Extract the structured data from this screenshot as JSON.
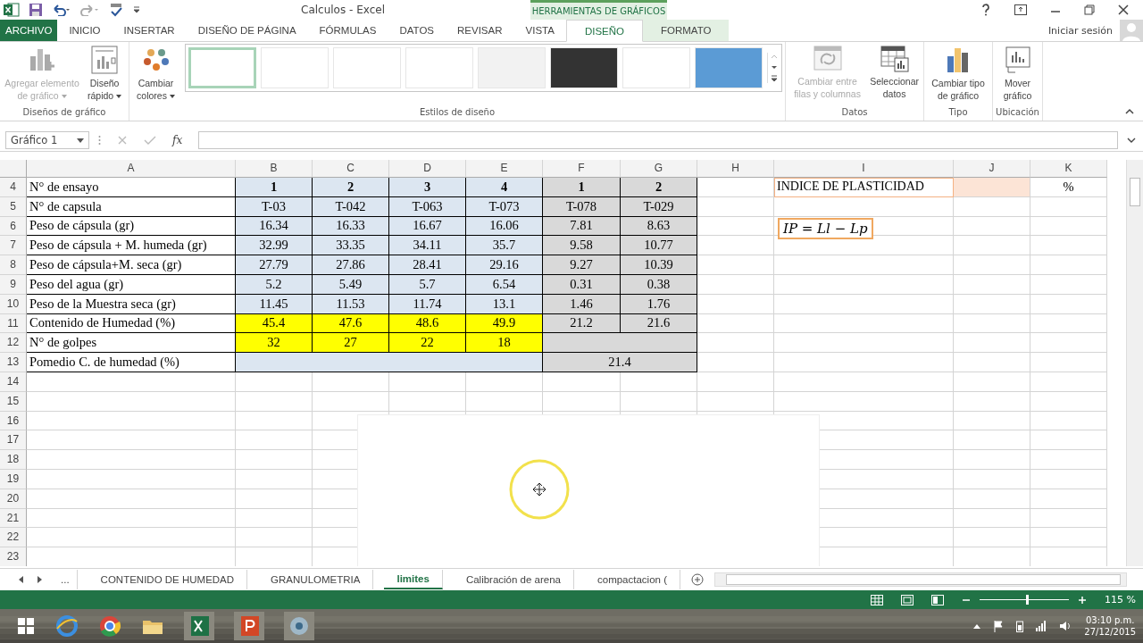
{
  "window": {
    "title": "Calculos - Excel",
    "contextual_header": "HERRAMIENTAS DE GRÁFICOS",
    "account": "Iniciar sesión"
  },
  "tabs": [
    {
      "label": "ARCHIVO",
      "kind": "file",
      "selected": false
    },
    {
      "label": "INICIO",
      "kind": "normal",
      "selected": false
    },
    {
      "label": "INSERTAR",
      "kind": "normal",
      "selected": false
    },
    {
      "label": "DISEÑO DE PÁGINA",
      "kind": "normal",
      "selected": false
    },
    {
      "label": "FÓRMULAS",
      "kind": "normal",
      "selected": false
    },
    {
      "label": "DATOS",
      "kind": "normal",
      "selected": false
    },
    {
      "label": "REVISAR",
      "kind": "normal",
      "selected": false
    },
    {
      "label": "VISTA",
      "kind": "normal",
      "selected": false
    },
    {
      "label": "DISEÑO",
      "kind": "contextual",
      "selected": true
    },
    {
      "label": "FORMATO",
      "kind": "contextual",
      "selected": false
    }
  ],
  "ribbon": {
    "groups": [
      {
        "label": "Diseños de gráfico",
        "buttons": [
          {
            "label": "Agregar elemento de gráfico",
            "disabled": true,
            "dropdown": true
          },
          {
            "label": "Diseño rápido",
            "disabled": false,
            "dropdown": true
          }
        ]
      },
      {
        "label": "Estilos de diseño",
        "buttons": [
          {
            "label": "Cambiar colores",
            "disabled": false,
            "dropdown": true
          }
        ],
        "gallery": [
          {
            "color": "#ffffff",
            "selected": true
          },
          {
            "color": "#ffffff",
            "selected": false
          },
          {
            "color": "#ffffff",
            "selected": false
          },
          {
            "color": "#ffffff",
            "selected": false
          },
          {
            "color": "#f2f2f2",
            "selected": false
          },
          {
            "color": "#333333",
            "selected": false
          },
          {
            "color": "#ffffff",
            "selected": false
          },
          {
            "color": "#5b9bd5",
            "selected": false
          }
        ]
      },
      {
        "label": "Datos",
        "buttons": [
          {
            "label": "Cambiar entre filas y columnas",
            "disabled": true,
            "dropdown": false
          },
          {
            "label": "Seleccionar datos",
            "disabled": false,
            "dropdown": false
          }
        ]
      },
      {
        "label": "Tipo",
        "buttons": [
          {
            "label": "Cambiar tipo de gráfico",
            "disabled": false,
            "dropdown": false
          }
        ]
      },
      {
        "label": "Ubicación",
        "buttons": [
          {
            "label": "Mover gráfico",
            "disabled": false,
            "dropdown": false
          }
        ]
      }
    ]
  },
  "formula_bar": {
    "name_box": "Gráfico 1",
    "fx": "fx"
  },
  "columns": [
    "A",
    "B",
    "C",
    "D",
    "E",
    "F",
    "G",
    "H",
    "I",
    "J",
    "K"
  ],
  "rows": [
    {
      "number": "4",
      "cells": [
        {
          "text": "N° de ensayo"
        },
        {
          "text": "1",
          "color": "#dce6f1",
          "bold": true
        },
        {
          "text": "2",
          "color": "#dce6f1",
          "bold": true
        },
        {
          "text": "3",
          "color": "#dce6f1",
          "bold": true
        },
        {
          "text": "4",
          "color": "#dce6f1",
          "bold": true
        },
        {
          "text": "1",
          "color": "#d9d9d9",
          "bold": true
        },
        {
          "text": "2",
          "color": "#d9d9d9",
          "bold": true
        },
        null,
        {
          "text": "INDICE DE PLASTICIDAD",
          "kind": "outlined"
        },
        {
          "color": "#fce4d6"
        },
        {
          "text": "%"
        }
      ]
    },
    {
      "number": "5",
      "cells": [
        {
          "text": "N° de capsula"
        },
        {
          "text": "T-03",
          "color": "#dce6f1"
        },
        {
          "text": "T-042",
          "color": "#dce6f1"
        },
        {
          "text": "T-063",
          "color": "#dce6f1"
        },
        {
          "text": "T-073",
          "color": "#dce6f1"
        },
        {
          "text": "T-078",
          "color": "#d9d9d9"
        },
        {
          "text": "T-029",
          "color": "#d9d9d9"
        },
        null,
        null,
        null,
        null
      ]
    },
    {
      "number": "6",
      "cells": [
        {
          "text": "Peso de cápsula  (gr)"
        },
        {
          "text": "16.34",
          "color": "#dce6f1"
        },
        {
          "text": "16.33",
          "color": "#dce6f1"
        },
        {
          "text": "16.67",
          "color": "#dce6f1"
        },
        {
          "text": "16.06",
          "color": "#dce6f1"
        },
        {
          "text": "7.81",
          "color": "#d9d9d9"
        },
        {
          "text": "8.63",
          "color": "#d9d9d9"
        },
        null,
        {
          "text": "IP = Ll − Lp",
          "kind": "formula"
        },
        null,
        null
      ]
    },
    {
      "number": "7",
      "cells": [
        {
          "text": "Peso de cápsula + M. humeda (gr)"
        },
        {
          "text": "32.99",
          "color": "#dce6f1"
        },
        {
          "text": "33.35",
          "color": "#dce6f1"
        },
        {
          "text": "34.11",
          "color": "#dce6f1"
        },
        {
          "text": "35.7",
          "color": "#dce6f1"
        },
        {
          "text": "9.58",
          "color": "#d9d9d9"
        },
        {
          "text": "10.77",
          "color": "#d9d9d9"
        },
        null,
        null,
        null,
        null
      ]
    },
    {
      "number": "8",
      "cells": [
        {
          "text": "Peso de cápsula+M. seca  (gr)"
        },
        {
          "text": "27.79",
          "color": "#dce6f1"
        },
        {
          "text": "27.86",
          "color": "#dce6f1"
        },
        {
          "text": "28.41",
          "color": "#dce6f1"
        },
        {
          "text": "29.16",
          "color": "#dce6f1"
        },
        {
          "text": "9.27",
          "color": "#d9d9d9"
        },
        {
          "text": "10.39",
          "color": "#d9d9d9"
        },
        null,
        null,
        null,
        null
      ]
    },
    {
      "number": "9",
      "cells": [
        {
          "text": "Peso del agua (gr)"
        },
        {
          "text": "5.2",
          "color": "#dce6f1"
        },
        {
          "text": "5.49",
          "color": "#dce6f1"
        },
        {
          "text": "5.7",
          "color": "#dce6f1"
        },
        {
          "text": "6.54",
          "color": "#dce6f1"
        },
        {
          "text": "0.31",
          "color": "#d9d9d9"
        },
        {
          "text": "0.38",
          "color": "#d9d9d9"
        },
        null,
        null,
        null,
        null
      ]
    },
    {
      "number": "10",
      "cells": [
        {
          "text": "Peso de la Muestra seca (gr)"
        },
        {
          "text": "11.45",
          "color": "#dce6f1"
        },
        {
          "text": "11.53",
          "color": "#dce6f1"
        },
        {
          "text": "11.74",
          "color": "#dce6f1"
        },
        {
          "text": "13.1",
          "color": "#dce6f1"
        },
        {
          "text": "1.46",
          "color": "#d9d9d9"
        },
        {
          "text": "1.76",
          "color": "#d9d9d9"
        },
        null,
        null,
        null,
        null
      ]
    },
    {
      "number": "11",
      "cells": [
        {
          "text": "Contenido de Humedad (%)"
        },
        {
          "text": "45.4",
          "color": "#ffff00"
        },
        {
          "text": "47.6",
          "color": "#ffff00"
        },
        {
          "text": "48.6",
          "color": "#ffff00"
        },
        {
          "text": "49.9",
          "color": "#ffff00"
        },
        {
          "text": "21.2",
          "color": "#d9d9d9"
        },
        {
          "text": "21.6",
          "color": "#d9d9d9"
        },
        null,
        null,
        null,
        null
      ]
    },
    {
      "number": "12",
      "cells": [
        {
          "text": "N° de golpes"
        },
        {
          "text": "32",
          "color": "#ffff00"
        },
        {
          "text": "27",
          "color": "#ffff00"
        },
        {
          "text": "22",
          "color": "#ffff00"
        },
        {
          "text": "18",
          "color": "#ffff00"
        },
        {
          "color": "#d9d9d9",
          "kind": "merged"
        },
        null,
        null,
        null,
        null,
        null
      ]
    },
    {
      "number": "13",
      "cells": [
        {
          "text": "Pomedio C. de humedad (%)"
        },
        {
          "color": "#dce6f1",
          "kind": "merged"
        },
        null,
        null,
        null,
        {
          "text": "21.4",
          "color": "#d9d9d9",
          "kind": "merged"
        },
        null,
        null,
        null,
        null,
        null
      ]
    }
  ],
  "empty_rows": [
    "14",
    "15",
    "16",
    "17",
    "18",
    "19",
    "20",
    "21",
    "22",
    "23"
  ],
  "sheet_tabs": [
    {
      "label": "CONTENIDO DE HUMEDAD",
      "selected": false
    },
    {
      "label": "GRANULOMETRIA",
      "selected": false
    },
    {
      "label": "limites",
      "selected": true
    },
    {
      "label": "Calibración de arena",
      "selected": false
    },
    {
      "label": "compactacion (",
      "selected": false
    }
  ],
  "sheet_nav": "...",
  "status_bar": {
    "zoom": "115 %",
    "zoom_slider": {
      "level": 0.53
    }
  },
  "taskbar": {
    "time": "03:10 p.m.",
    "date": "27/12/2015"
  }
}
